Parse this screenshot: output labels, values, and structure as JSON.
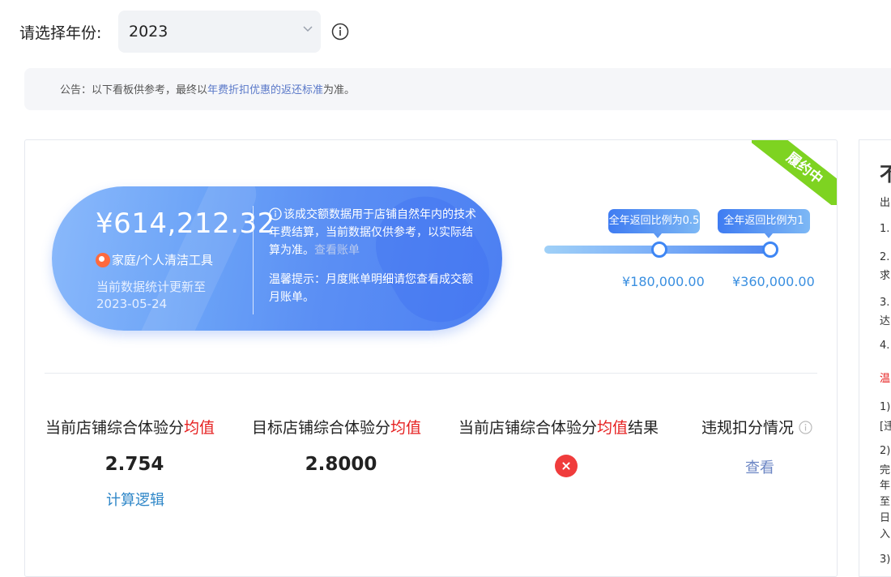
{
  "header": {
    "year_label": "请选择年份:",
    "year_value": "2023"
  },
  "notice": {
    "prefix": "公告：以下看板供参考，最终以",
    "link": "年费折扣优惠的返还标准",
    "suffix": "为准。"
  },
  "summary": {
    "status_ribbon": "履约中",
    "amount": "¥614,212.32",
    "category": "家庭/个人清洁工具",
    "updated_label": "当前数据统计更新至",
    "updated_date": "2023-05-24",
    "desc_text": "该成交额数据用于店铺自然年内的技术年费结算，当前数据仅供参考，以实际结算为准。",
    "desc_link": "查看账单",
    "tip_text": "温馨提示：月度账单明细请您查看成交额月账单。"
  },
  "milestones": [
    {
      "label": "全年返回比例为0.5",
      "value": "¥180,000.00"
    },
    {
      "label": "全年返回比例为1",
      "value": "¥360,000.00"
    }
  ],
  "metrics": {
    "current": {
      "label_pre": "当前店铺综合体验分",
      "label_red": "均值",
      "label_post": "",
      "value": "2.754",
      "link": "计算逻辑"
    },
    "target": {
      "label_pre": "目标店铺综合体验分",
      "label_red": "均值",
      "label_post": "",
      "value": "2.8000"
    },
    "result": {
      "label_pre": "当前店铺综合体验分",
      "label_red": "均值",
      "label_post": "结果"
    },
    "violation": {
      "label": "违规扣分情况",
      "link": "查看"
    }
  },
  "side_panel": {
    "lines": [
      "不",
      "出",
      "1.",
      "2.",
      "求",
      "3.",
      "达",
      "4.",
      "温",
      "1)",
      "[违",
      "2)",
      "完",
      "年",
      "至",
      "日",
      "入",
      "3)"
    ]
  },
  "colors": {
    "accent_blue": "#4f86f0",
    "ribbon_green": "#7ed321",
    "warning_red": "#e62020"
  }
}
